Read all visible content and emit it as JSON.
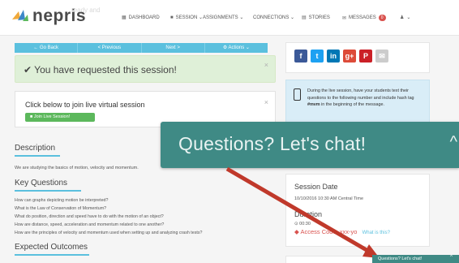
{
  "nav": {
    "logo_text": "nepris",
    "ghost_text": "ready and",
    "items": [
      {
        "icon": "▦",
        "label": "DASHBOARD"
      },
      {
        "icon": "■",
        "label": "SESSION ⌄"
      },
      {
        "icon": "",
        "label": "ASSIGNMENTS ⌄"
      },
      {
        "icon": "",
        "label": "CONNECTIONS ⌄"
      },
      {
        "icon": "▤",
        "label": "STORIES"
      },
      {
        "icon": "✉",
        "label": "MESSAGES"
      },
      {
        "icon": "♟",
        "label": "⌄"
      }
    ],
    "messages_count": "0"
  },
  "actions": {
    "go_back": "← Go Back",
    "previous": "< Previous",
    "next": "Next >",
    "actions": "⚙ Actions ⌄"
  },
  "alert": {
    "text": "✔ You have requested this session!",
    "close": "×"
  },
  "join": {
    "title": "Click below to join live virtual session",
    "button": "■ Join Live Session!",
    "close": "×"
  },
  "description": {
    "heading": "Description",
    "text": "We are studying the basics of motion, velocity and momentum."
  },
  "key_questions": {
    "heading": "Key Questions",
    "items": [
      "How can graphs depicting motion be interpreted?",
      "What is the Law of Conservation of Momentum?",
      "What do position, direction and speed have to do with the motion of an object?",
      "How are distance, speed, acceleration and momentum related to one another?",
      "How are the principles of velocity and momentum used when setting up and analyzing crash tests?"
    ]
  },
  "expected": {
    "heading": "Expected Outcomes"
  },
  "social": {
    "icons": [
      "f",
      "t",
      "in",
      "g+",
      "P",
      "✉"
    ],
    "colors": [
      "#3b5998",
      "#1da1f2",
      "#0077b5",
      "#dd4b39",
      "#cb2027",
      "#cccccc"
    ]
  },
  "info": {
    "text_before": "During the live session, have your students text their questions to the following number and include hash tag ",
    "hashtag": "#mvm",
    "text_after": " in the beginning of the message."
  },
  "session": {
    "title": "Session Date",
    "date_line": "10/10/2016 10:30 AM  Central Time",
    "duration_title": "Duration",
    "duration_value": "⊙ 00:30",
    "access_label": "◆ Access Code: ",
    "access_code": "xxx-yo",
    "access_link": "What is this?"
  },
  "chat": {
    "big_label": "Questions? Let's chat!",
    "small_label": "Questions? Let's chat!",
    "chevron": "^",
    "color": "#3f8a85"
  },
  "annotation": {
    "arrow_color": "#c0392b"
  }
}
